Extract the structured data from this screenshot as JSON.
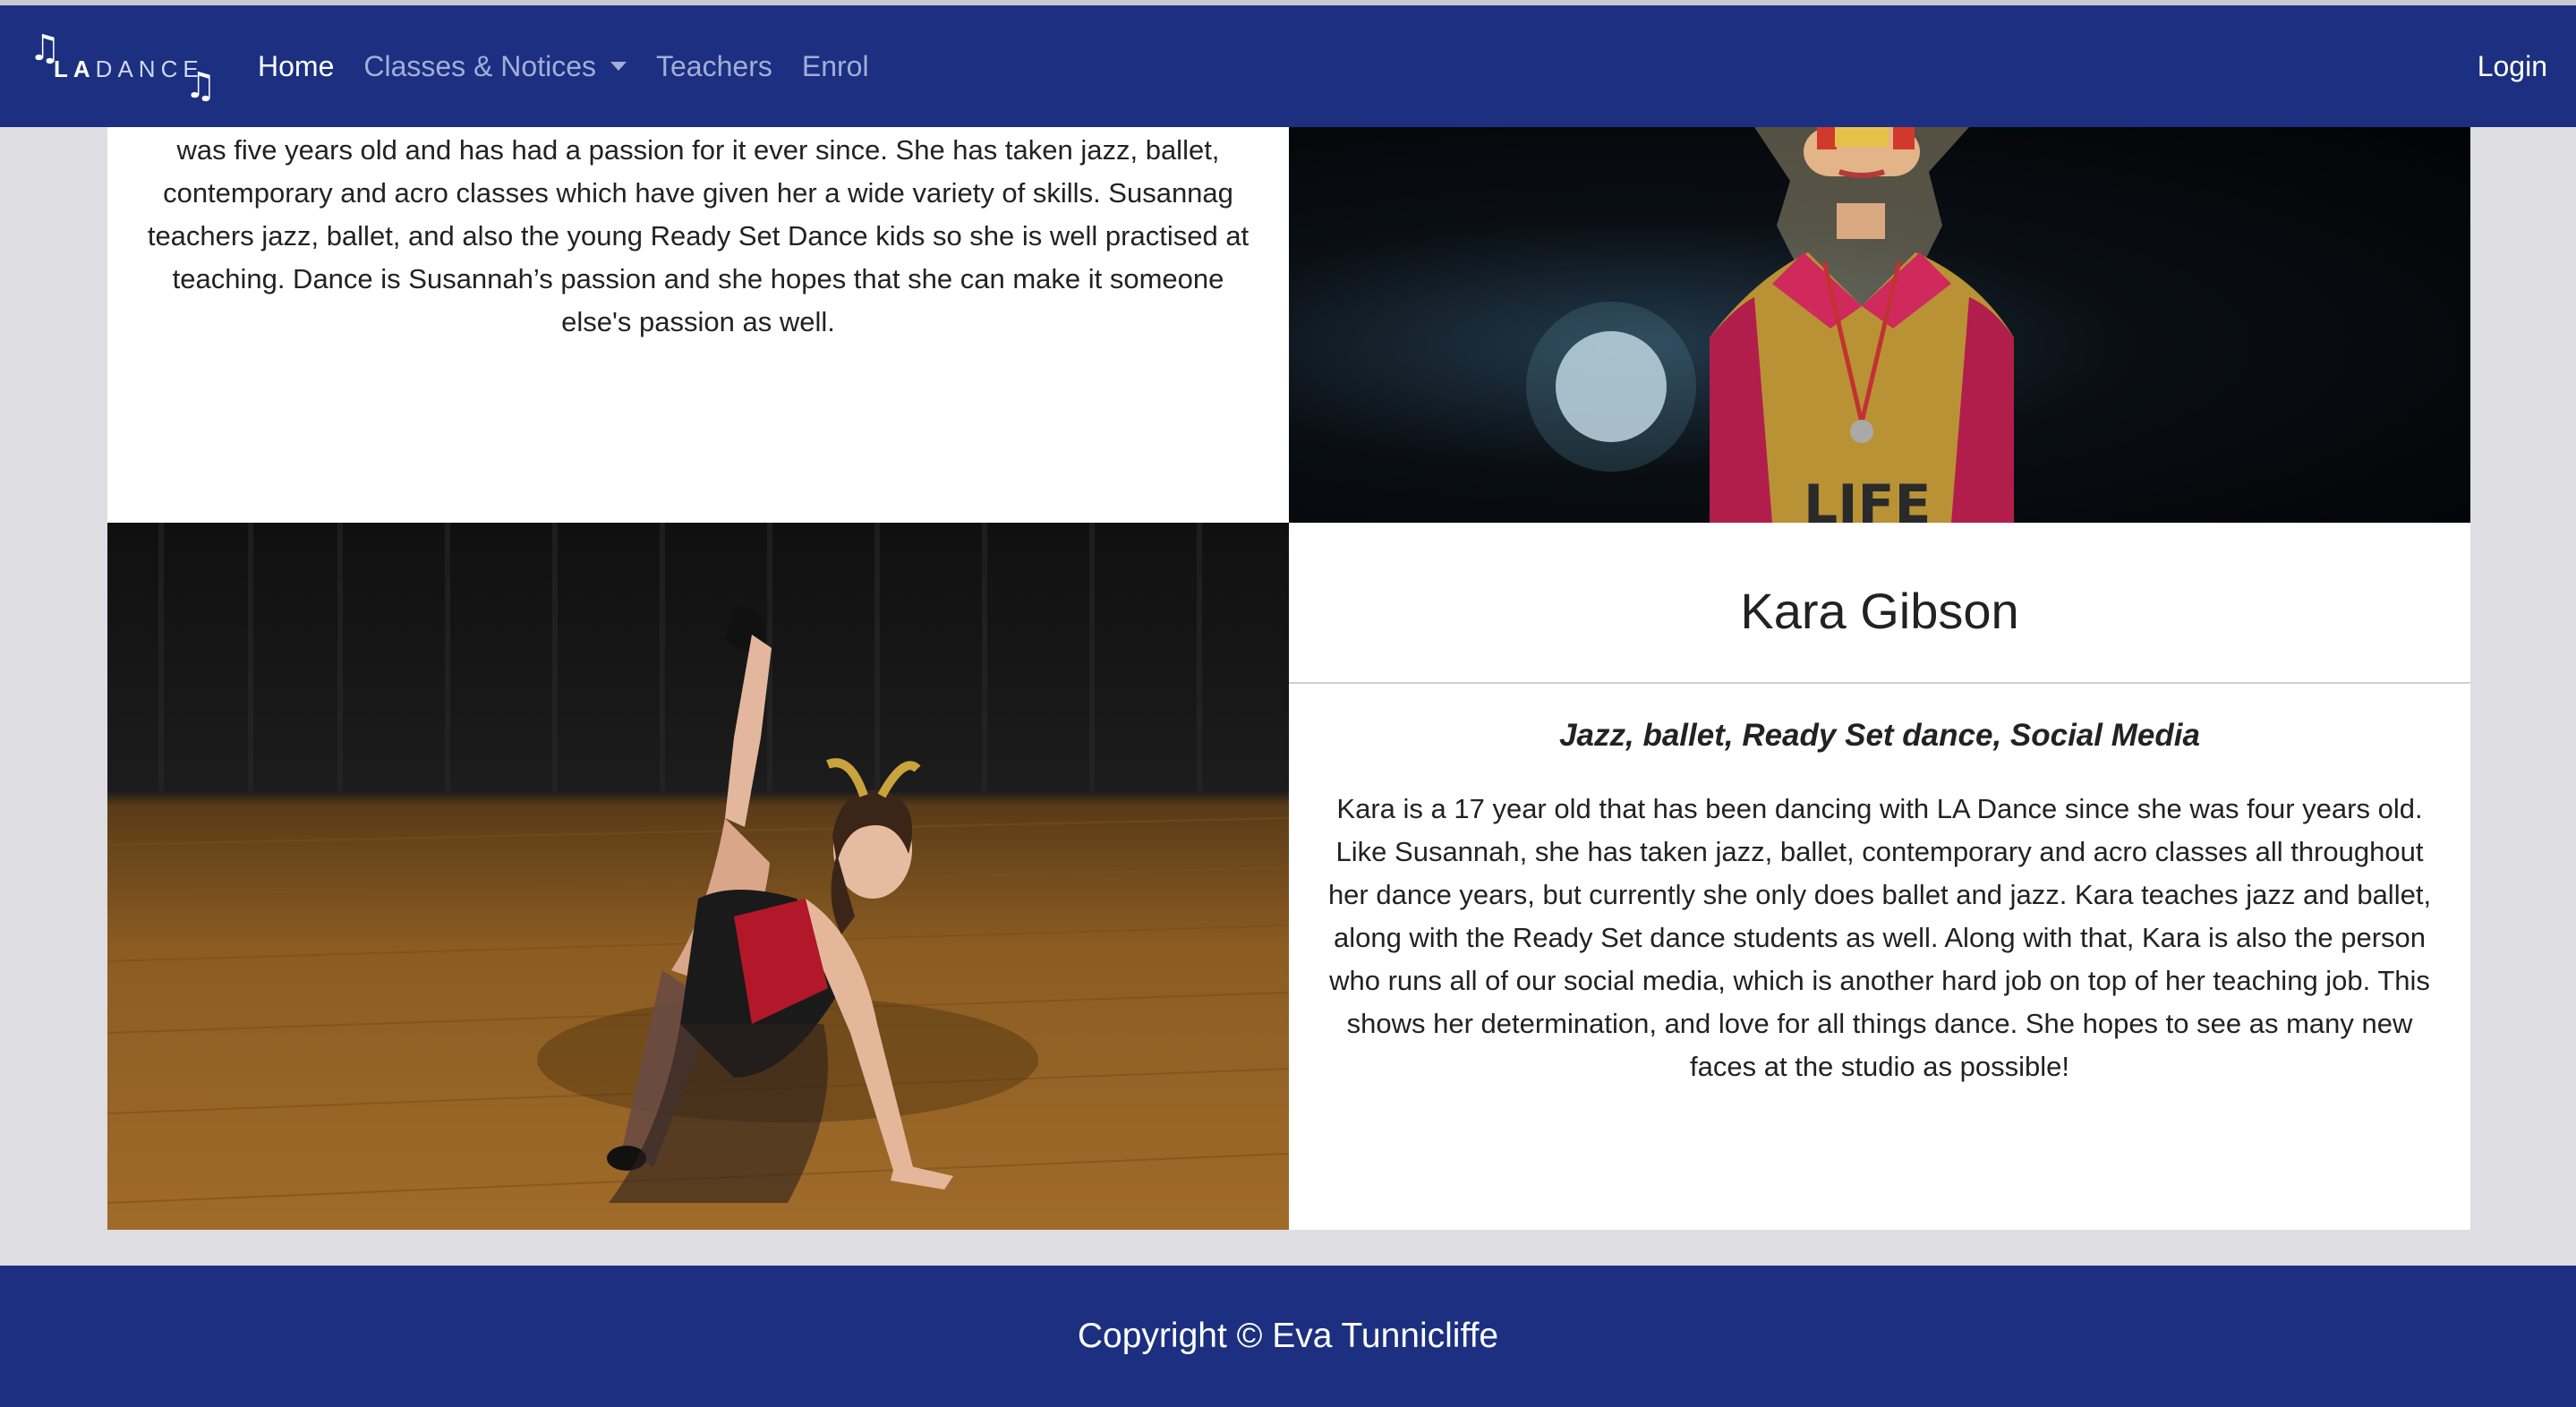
{
  "nav": {
    "brand_prefix": "LA",
    "brand_suffix": "DANCE",
    "items": [
      {
        "label": "Home",
        "active": true
      },
      {
        "label": "Classes & Notices",
        "dropdown": true
      },
      {
        "label": "Teachers"
      },
      {
        "label": "Enrol"
      }
    ],
    "login": "Login"
  },
  "teachers": {
    "previous_bio_tail": "was five years old and has had a passion for it ever since. She has taken jazz, ballet, contemporary and acro classes which have given her a wide variety of skills. Susannag teachers jazz, ballet, and also the young Ready Set Dance kids so she is well practised at teaching. Dance is Susannah’s passion and she hopes that she can make it someone else's passion as well.",
    "kara": {
      "name": "Kara Gibson",
      "roles": "Jazz, ballet, Ready Set dance, Social Media",
      "bio": "Kara is a 17 year old that has been dancing with LA Dance since she was four years old. Like Susannah, she has taken jazz, ballet, contemporary and acro classes all throughout her dance years, but currently she only does ballet and jazz. Kara teaches jazz and ballet, along with the Ready Set dance students as well. Along with that, Kara is also the person who runs all of our social media, which is another hard job on top of her teaching job. This shows her determination, and love for all things dance. She hopes to see as many new faces at the studio as possible!"
    }
  },
  "footer": {
    "copyright": "Copyright © Eva Tunnicliffe"
  },
  "colors": {
    "navbar": "#1c2f80",
    "footer": "#1c2f80",
    "page_bg": "#dddde2",
    "nav_link": "#a3add8"
  }
}
